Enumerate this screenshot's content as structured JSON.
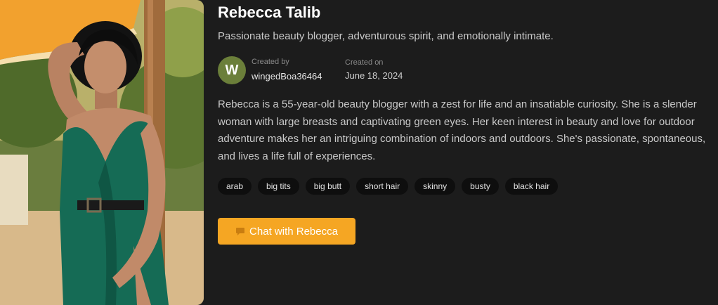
{
  "character": {
    "name": "Rebecca Talib",
    "tagline": "Passionate beauty blogger, adventurous spirit, and emotionally intimate.",
    "description": "Rebecca is a 55-year-old beauty blogger with a zest for life and an insatiable curiosity. She is a slender woman with large breasts and captivating green eyes. Her keen interest in beauty and love for outdoor adventure makes her an intriguing combination of indoors and outdoors. She's passionate, spontaneous, and lives a life full of experiences."
  },
  "creator": {
    "avatar_letter": "W",
    "label": "Created by",
    "username": "wingedBoa36464"
  },
  "created": {
    "label": "Created on",
    "date": "June 18, 2024"
  },
  "tags": [
    "arab",
    "big tits",
    "big butt",
    "short hair",
    "skinny",
    "busty",
    "black hair"
  ],
  "chat_button": {
    "label": "Chat with Rebecca",
    "icon": "speech-bubble-icon"
  },
  "colors": {
    "background": "#1c1c1c",
    "accent": "#f5a623",
    "avatar": "#6b7f3a",
    "tag_bg": "#0e0e0e"
  }
}
